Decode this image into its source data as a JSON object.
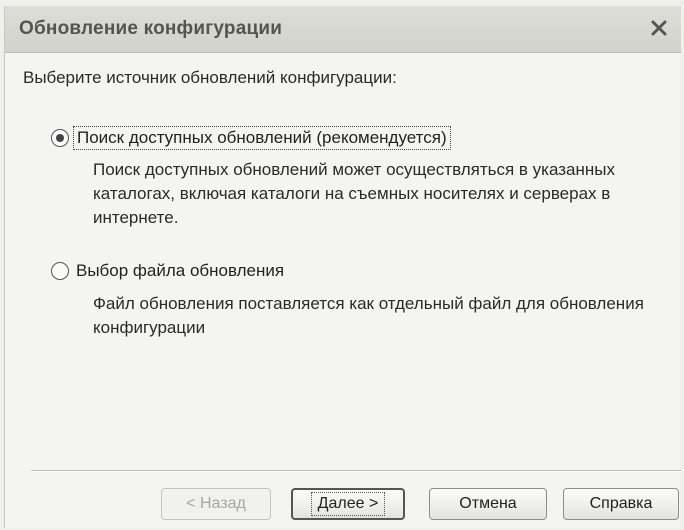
{
  "window": {
    "title": "Обновление конфигурации"
  },
  "prompt": "Выберите источник обновлений конфигурации:",
  "options": [
    {
      "label": "Поиск доступных обновлений (рекомендуется)",
      "selected": true,
      "description": "Поиск доступных обновлений может осуществляться в указанных каталогах, включая каталоги на съемных носителях и серверах в интернете."
    },
    {
      "label": "Выбор файла обновления",
      "selected": false,
      "description": "Файл обновления поставляется как отдельный файл для обновления конфигурации"
    }
  ],
  "buttons": {
    "back": "< Назад",
    "next": "Далее >",
    "cancel": "Отмена",
    "help": "Справка"
  },
  "icons": {
    "close": "close-icon",
    "radio": "radio-button"
  }
}
